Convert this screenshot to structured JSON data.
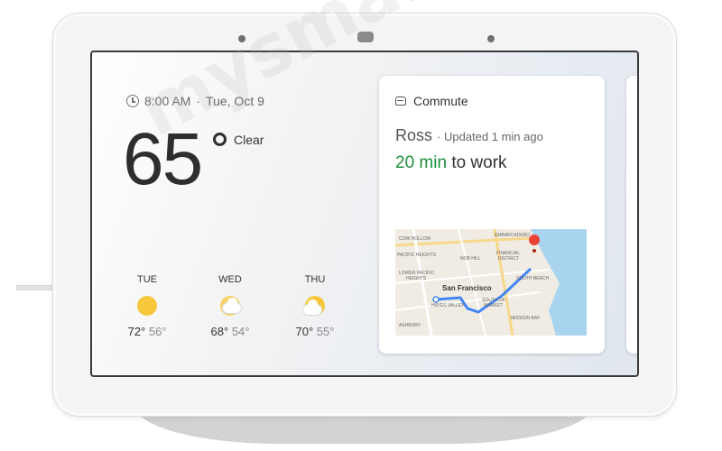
{
  "status": {
    "time": "8:00 AM",
    "separator": "·",
    "date": "Tue, Oct 9"
  },
  "weather": {
    "current_temp": "65",
    "condition": "Clear",
    "forecast": [
      {
        "day": "TUE",
        "icon": "sun-icon",
        "high": "72°",
        "low": "56°"
      },
      {
        "day": "WED",
        "icon": "partly-cloudy-icon",
        "high": "68°",
        "low": "54°"
      },
      {
        "day": "THU",
        "icon": "partly-cloudy-icon",
        "high": "70°",
        "low": "55°"
      }
    ]
  },
  "commute": {
    "title": "Commute",
    "name": "Ross",
    "updated": "· Updated 1 min ago",
    "duration": "20 min",
    "suffix": "to work",
    "map_labels": {
      "cow_hollow": "COW HOLLOW",
      "embarcadero": "EMBARCADERO",
      "pacific_heights": "PACIFIC HEIGHTS",
      "nob_hill": "NOB HILL",
      "financial": "FINANCIAL",
      "district": "DISTRICT",
      "lower_pacific": "LOWER PACIFIC",
      "heights": "HEIGHTS",
      "south_beach": "SOUTH BEACH",
      "san_francisco": "San Francisco",
      "hayes_valley": "HAYES VALLEY",
      "south_of": "SOUTH OF",
      "market": "MARKET",
      "mission_bay": "MISSION BAY",
      "ashbury": "ASHBURY"
    },
    "route_color": "#4285f4",
    "pin_color": "#ea4335"
  },
  "watermark": "mysmartprice",
  "colors": {
    "sun": "#f7c83b",
    "eta_green": "#1e8e3e"
  }
}
